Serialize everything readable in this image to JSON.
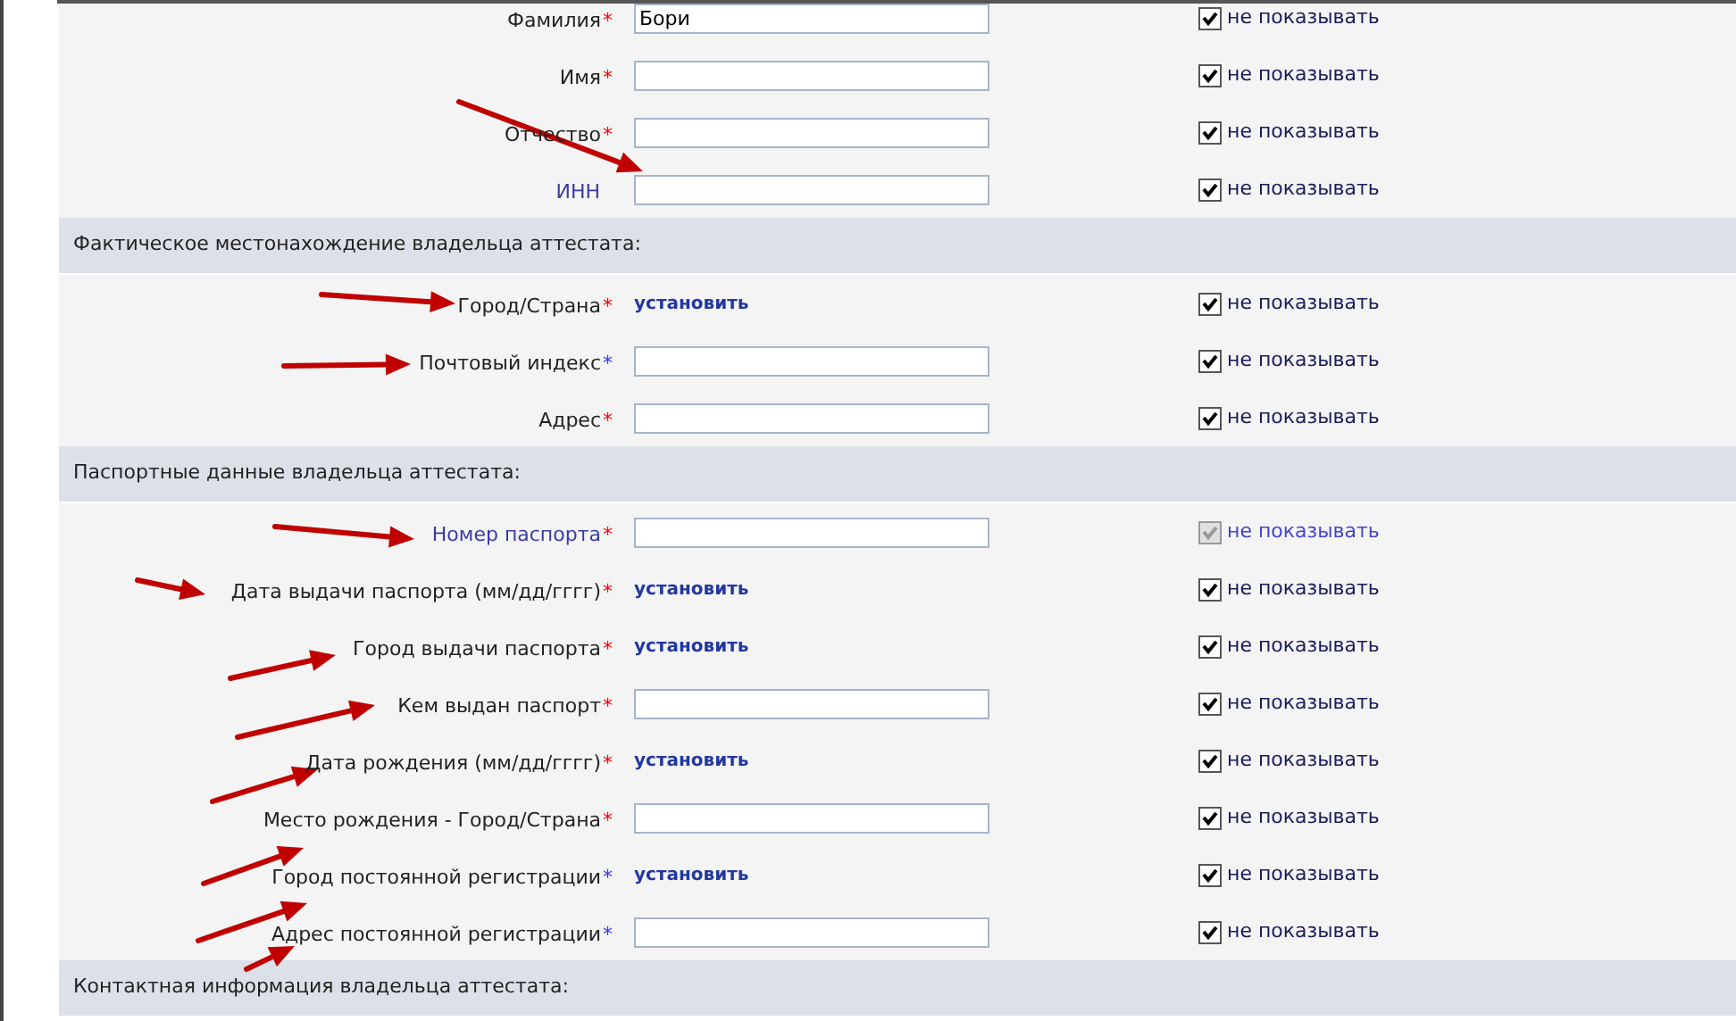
{
  "sections": [
    {
      "rows": [
        {
          "kind": "input",
          "label": "Фамилия",
          "link": false,
          "mark": "*",
          "color": "#ff0000",
          "value": "Бори",
          "hide_label": "не показывать",
          "hide_checked": true,
          "hide_disabled": false
        },
        {
          "kind": "input",
          "label": "Имя",
          "link": false,
          "mark": "*",
          "color": "#ff0000",
          "hide_label": "не показывать",
          "hide_checked": true,
          "hide_disabled": false
        },
        {
          "kind": "input",
          "label": "Отчество",
          "link": false,
          "mark": "*",
          "color": "#ff0000",
          "hide_label": "не показывать",
          "hide_checked": true,
          "hide_disabled": false
        },
        {
          "kind": "input",
          "label": "ИНН",
          "link": true,
          "hide_label": "не показывать",
          "hide_checked": true,
          "hide_disabled": false
        }
      ]
    },
    {
      "title": "Фактическое местонахождение владельца аттестата:",
      "rows": [
        {
          "kind": "action",
          "label": "Город/Страна",
          "link": false,
          "mark": "*",
          "color": "#ff0000",
          "action": "установить",
          "hide_label": "не показывать",
          "hide_checked": true,
          "hide_disabled": false
        },
        {
          "kind": "input",
          "label": "Почтовый индекс",
          "link": false,
          "mark": "*",
          "color": "#3333ff",
          "hide_label": "не показывать",
          "hide_checked": true,
          "hide_disabled": false
        },
        {
          "kind": "input",
          "label": "Адрес",
          "link": false,
          "mark": "*",
          "color": "#ff0000",
          "hide_label": "не показывать",
          "hide_checked": true,
          "hide_disabled": false
        }
      ]
    },
    {
      "title": "Паспортные данные владельца аттестата:",
      "rows": [
        {
          "kind": "input",
          "label": "Номер паспорта",
          "link": true,
          "mark": "*",
          "color": "#ff0000",
          "hide_label": "не показывать",
          "hide_checked": true,
          "hide_disabled": true
        },
        {
          "kind": "action",
          "label": "Дата выдачи паспорта (мм/дд/гггг)",
          "link": false,
          "mark": "*",
          "color": "#ff0000",
          "action": "установить",
          "hide_label": "не показывать",
          "hide_checked": true,
          "hide_disabled": false
        },
        {
          "kind": "action",
          "label": "Город выдачи паспорта",
          "link": false,
          "mark": "*",
          "color": "#ff0000",
          "action": "установить",
          "hide_label": "не показывать",
          "hide_checked": true,
          "hide_disabled": false
        },
        {
          "kind": "input",
          "label": "Кем выдан паспорт",
          "link": false,
          "mark": "*",
          "color": "#ff0000",
          "hide_label": "не показывать",
          "hide_checked": true,
          "hide_disabled": false
        },
        {
          "kind": "action",
          "label": "Дата рождения (мм/дд/гггг)",
          "link": false,
          "mark": "*",
          "color": "#ff0000",
          "action": "установить",
          "hide_label": "не показывать",
          "hide_checked": true,
          "hide_disabled": false
        },
        {
          "kind": "input",
          "label": "Место рождения - Город/Страна",
          "link": false,
          "mark": "*",
          "color": "#ff0000",
          "hide_label": "не показывать",
          "hide_checked": true,
          "hide_disabled": false
        },
        {
          "kind": "action",
          "label": "Город постоянной регистрации",
          "link": false,
          "mark": "*",
          "color": "#3333ff",
          "action": "установить",
          "hide_label": "не показывать",
          "hide_checked": true,
          "hide_disabled": false
        },
        {
          "kind": "input",
          "label": "Адрес постоянной регистрации",
          "link": false,
          "mark": "*",
          "color": "#3333ff",
          "hide_label": "не показывать",
          "hide_checked": true,
          "hide_disabled": false
        }
      ]
    },
    {
      "title": "Контактная информация владельца аттестата:"
    }
  ]
}
